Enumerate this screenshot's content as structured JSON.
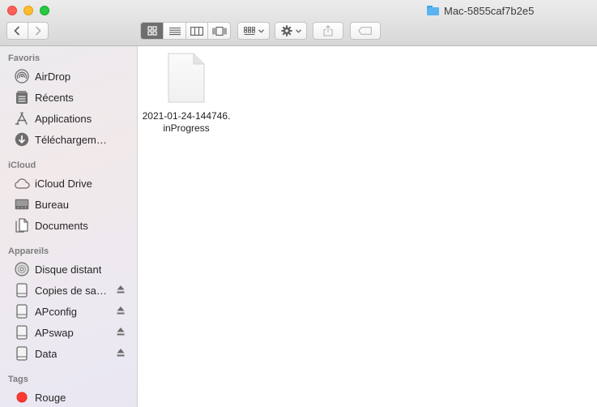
{
  "window": {
    "title": "Mac-5855caf7b2e5",
    "title_icon": "folder-icon"
  },
  "toolbar": {
    "back_icon": "chevron-left-icon",
    "forward_icon": "chevron-right-icon",
    "views": [
      "icon-view-icon",
      "list-view-icon",
      "column-view-icon",
      "gallery-view-icon"
    ],
    "active_view": "icon-view",
    "arrange_icon": "group-icon",
    "action_icon": "gear-icon",
    "share_icon": "share-icon",
    "tag_icon": "tag-icon"
  },
  "sidebar": {
    "sections": [
      {
        "title": "Favoris",
        "items": [
          {
            "label": "AirDrop",
            "icon": "airdrop-icon"
          },
          {
            "label": "Récents",
            "icon": "recents-icon"
          },
          {
            "label": "Applications",
            "icon": "applications-icon"
          },
          {
            "label": "Téléchargements",
            "icon": "downloads-icon"
          }
        ]
      },
      {
        "title": "iCloud",
        "items": [
          {
            "label": "iCloud Drive",
            "icon": "cloud-icon"
          },
          {
            "label": "Bureau",
            "icon": "desktop-icon"
          },
          {
            "label": "Documents",
            "icon": "documents-icon"
          }
        ]
      },
      {
        "title": "Appareils",
        "items": [
          {
            "label": "Disque distant",
            "icon": "disc-icon"
          },
          {
            "label": "Copies de sauvegarde",
            "icon": "drive-icon",
            "eject": true
          },
          {
            "label": "APconfig",
            "icon": "drive-icon",
            "eject": true
          },
          {
            "label": "APswap",
            "icon": "drive-icon",
            "eject": true
          },
          {
            "label": "Data",
            "icon": "drive-icon",
            "eject": true
          }
        ]
      },
      {
        "title": "Tags",
        "items": [
          {
            "label": "Rouge",
            "icon": "red-tag-icon",
            "color": "#fe3b30"
          }
        ]
      }
    ]
  },
  "content": {
    "files": [
      {
        "name": "2021-01-24-144746.inProgress",
        "icon": "document-icon"
      }
    ]
  },
  "colors": {
    "accent_folder": "#59b4f0",
    "tag_red": "#fe3b30"
  }
}
